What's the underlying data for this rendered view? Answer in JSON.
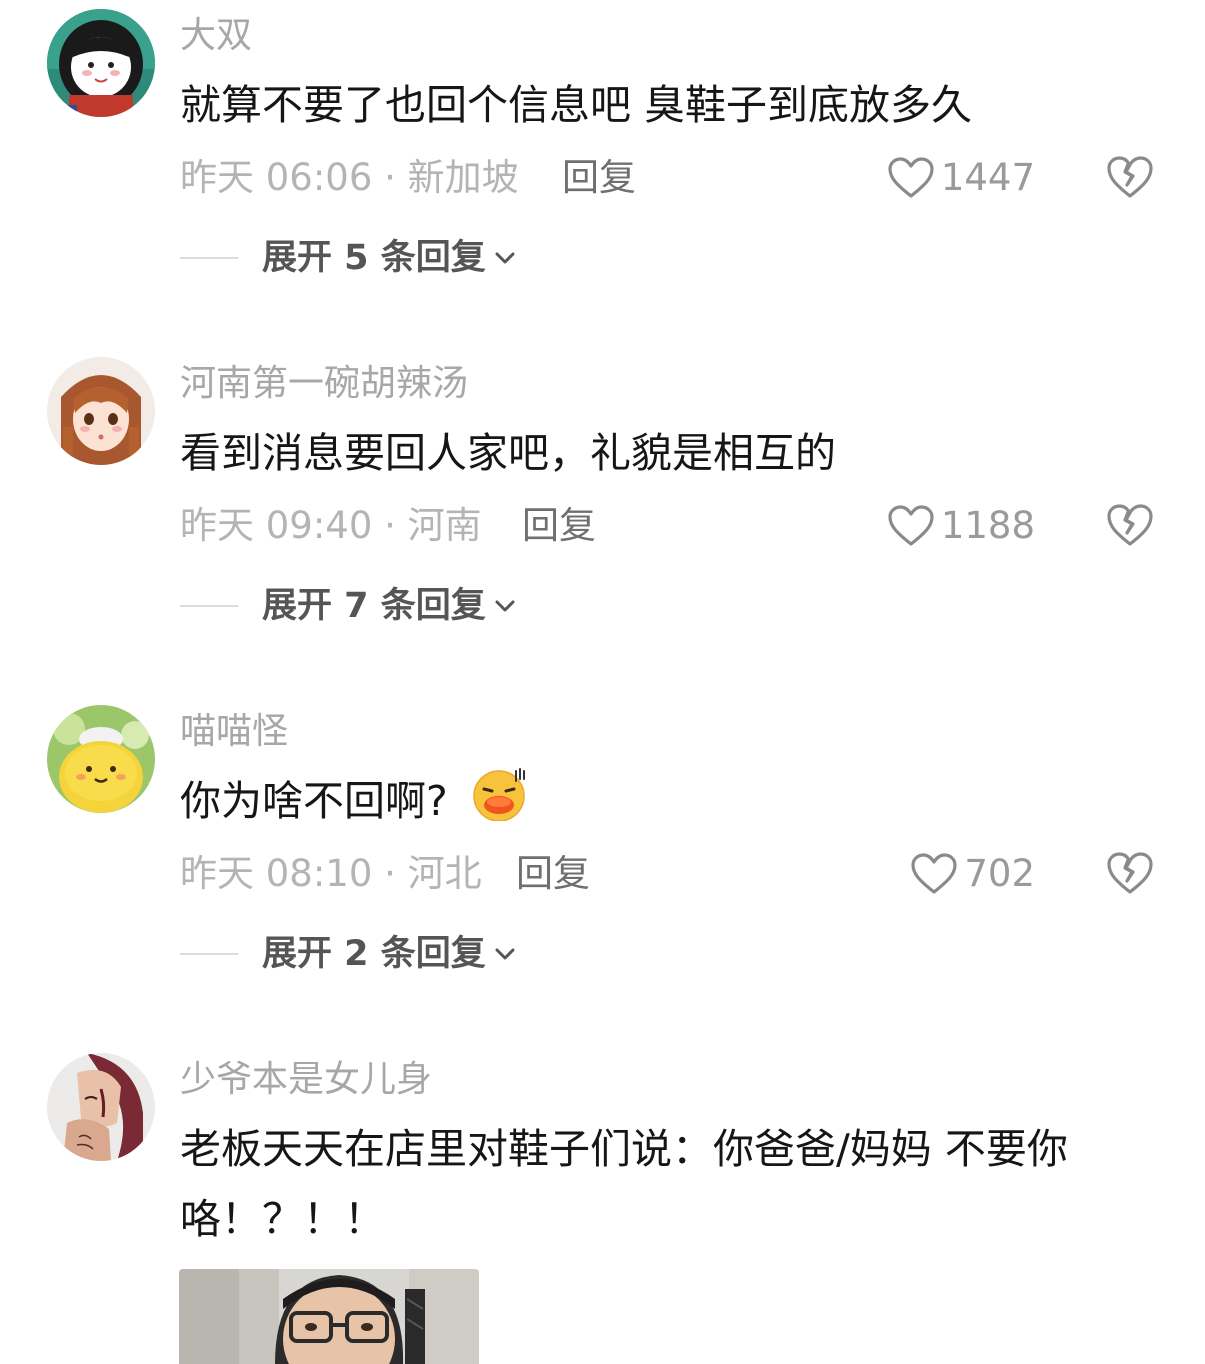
{
  "comments": [
    {
      "username": "大双",
      "content": "就算不要了也回个信息吧 臭鞋子到底放多久",
      "meta": "昨天 06:06 · 新加坡",
      "reply_label": "回复",
      "likes": "1447",
      "expand_label": "展开 5 条回复",
      "avatar_icon": "cartoon-girl-avatar"
    },
    {
      "username": "河南第一碗胡辣汤",
      "content": "看到消息要回人家吧，礼貌是相互的",
      "meta": "昨天 09:40 · 河南",
      "reply_label": "回复",
      "likes": "1188",
      "expand_label": "展开 7 条回复",
      "avatar_icon": "anime-girl-avatar"
    },
    {
      "username": "喵喵怪",
      "content": "你为啥不回啊?",
      "meta": "昨天 08:10 · 河北",
      "reply_label": "回复",
      "likes": "702",
      "expand_label": "展开 2 条回复",
      "avatar_icon": "yellow-chick-avatar",
      "emoji_icon": "duck-lips-emoji"
    },
    {
      "username": "少爷本是女儿身",
      "content": "老板天天在店里对鞋子们说：你爸爸/妈妈 不要你咯！？！！",
      "avatar_icon": "tattoo-woman-avatar",
      "attached_image": "person-with-glasses-photo"
    }
  ],
  "colors": {
    "username": "#a7a7a7",
    "content": "#161616",
    "meta": "#b4b4b4",
    "reply": "#6f6f6f",
    "expand": "#555555"
  }
}
